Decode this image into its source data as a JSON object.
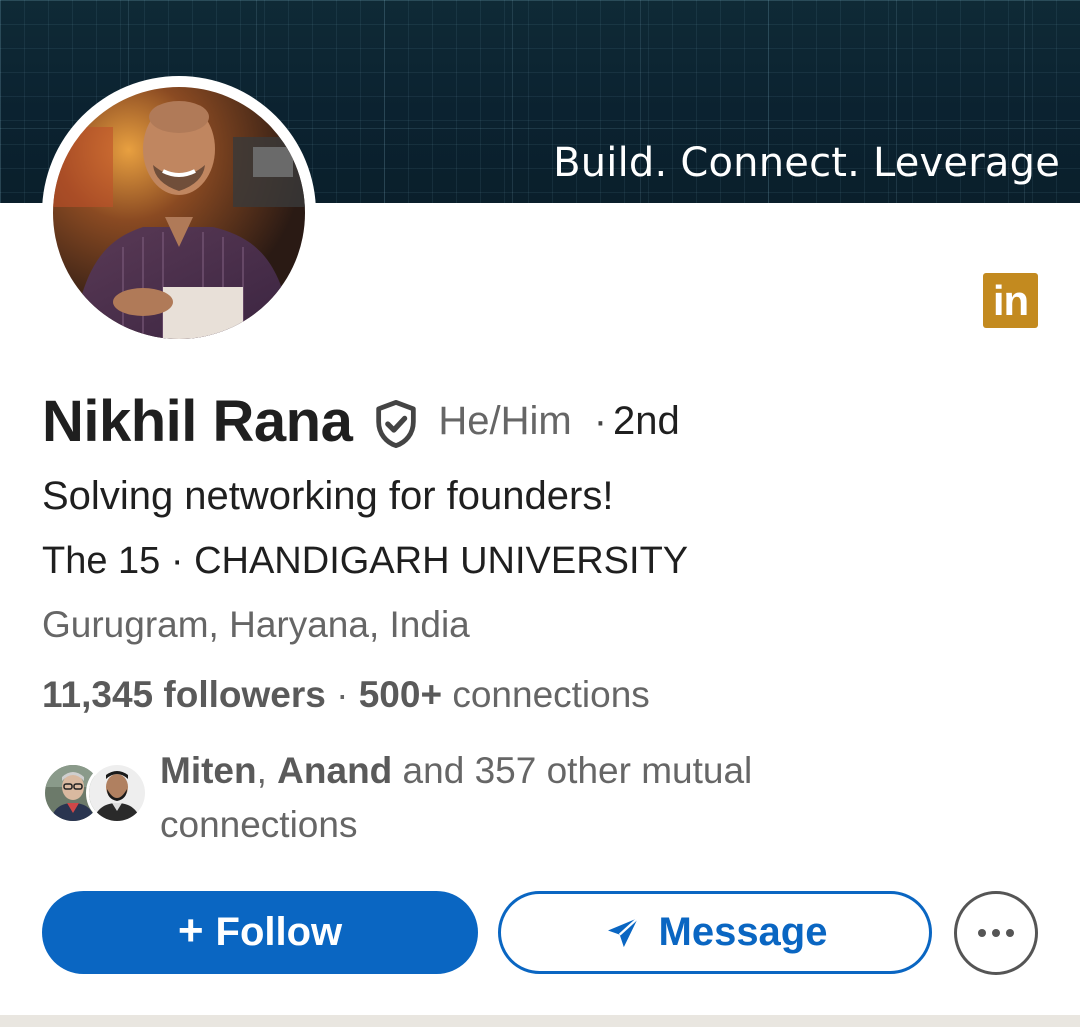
{
  "banner": {
    "tagline": "Build. Connect. Leverage",
    "background_color": "#0b2230"
  },
  "profile": {
    "avatar_icon": "profile-photo",
    "name": "Nikhil Rana",
    "verified_icon": "verified-shield-icon",
    "pronouns": "He/Him",
    "degree_separator": "·",
    "degree": "2nd",
    "headline": "Solving networking for founders!",
    "org_line": "The 15 · CHANDIGARH UNIVERSITY",
    "location": "Gurugram, Haryana, India"
  },
  "stats": {
    "followers_count": "11,345 followers",
    "separator": " · ",
    "connections_count": "500+",
    "connections_label": " connections"
  },
  "mutual": {
    "name_1": "Miten",
    "comma": ", ",
    "name_2": "Anand",
    "rest": " and 357 other mutual connections"
  },
  "actions": {
    "follow_plus": "+",
    "follow_label": "Follow",
    "message_label": "Message",
    "more_icon": "more-horizontal-icon"
  },
  "colors": {
    "primary": "#0a66c2",
    "linkedin_badge": "#c38a1f",
    "secondary_text": "#666666"
  },
  "linkedin_badge": {
    "text": "in"
  }
}
